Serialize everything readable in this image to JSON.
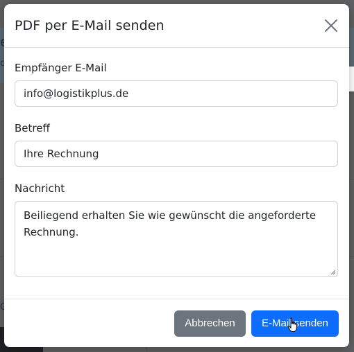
{
  "background": {
    "chars": [
      "e",
      "c",
      "G"
    ]
  },
  "modal": {
    "title": "PDF per E-Mail senden",
    "close_icon": "close-icon",
    "fields": {
      "recipient": {
        "label": "Empfänger E-Mail",
        "value": "info@logistikplus.de"
      },
      "subject": {
        "label": "Betreff",
        "value": "Ihre Rechnung"
      },
      "message": {
        "label": "Nachricht",
        "value": "Beiliegend erhalten Sie wie gewünscht die angeforderte Rechnung."
      }
    },
    "buttons": {
      "cancel": "Abbrechen",
      "send": "E-Mail senden"
    }
  },
  "colors": {
    "primary": "#0d6efd",
    "secondary": "#6c757d",
    "widget_accent": "#1f9d57"
  },
  "side_widget": {
    "icon": "chat-bot-icon"
  }
}
